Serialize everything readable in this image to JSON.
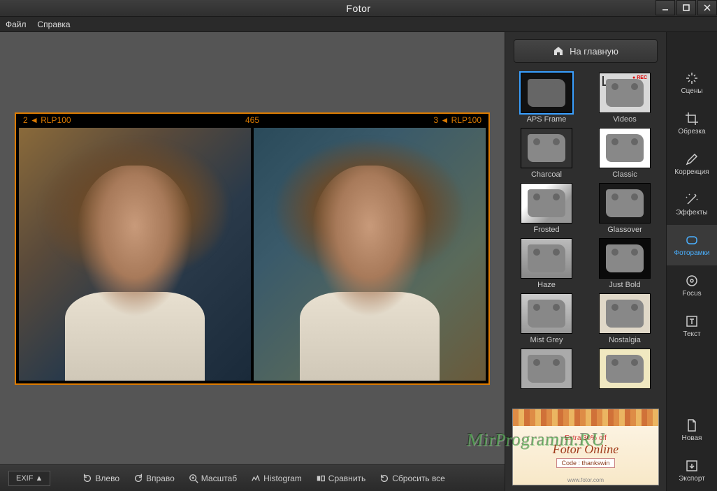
{
  "app": {
    "title": "Fotor"
  },
  "menu": {
    "file": "Файл",
    "help": "Справка"
  },
  "film": {
    "left": "2 ◄ RLP100",
    "mid": "465",
    "right": "3 ◄ RLP100"
  },
  "bottom": {
    "exif": "EXIF ▲",
    "rotate_left": "Влево",
    "rotate_right": "Вправо",
    "zoom": "Масштаб",
    "histogram": "Histogram",
    "compare": "Сравнить",
    "reset": "Сбросить все"
  },
  "home_button": "На главную",
  "frames": [
    {
      "label": "APS Frame",
      "cls": "black sel"
    },
    {
      "label": "Videos",
      "cls": "videos"
    },
    {
      "label": "Charcoal",
      "cls": "charcoal"
    },
    {
      "label": "Classic",
      "cls": "white"
    },
    {
      "label": "Frosted",
      "cls": "frosted"
    },
    {
      "label": "Glassover",
      "cls": "glass"
    },
    {
      "label": "Haze",
      "cls": "haze"
    },
    {
      "label": "Just Bold",
      "cls": "bold"
    },
    {
      "label": "Mist Grey",
      "cls": "mist"
    },
    {
      "label": "Nostalgia",
      "cls": "nost"
    },
    {
      "label": "",
      "cls": "plain"
    },
    {
      "label": "",
      "cls": "cream"
    }
  ],
  "promo": {
    "extra": "Extra 30% off",
    "title": "Fotor Online",
    "code": "Code : thankswin",
    "site": "www.fotor.com"
  },
  "sidebar": {
    "scenes": "Сцены",
    "crop": "Обрезка",
    "correction": "Коррекция",
    "effects": "Эффекты",
    "frames": "Фоторамки",
    "focus": "Focus",
    "text": "Текст",
    "new": "Новая",
    "export": "Экспорт"
  },
  "watermark": "MirProgramm.RU"
}
